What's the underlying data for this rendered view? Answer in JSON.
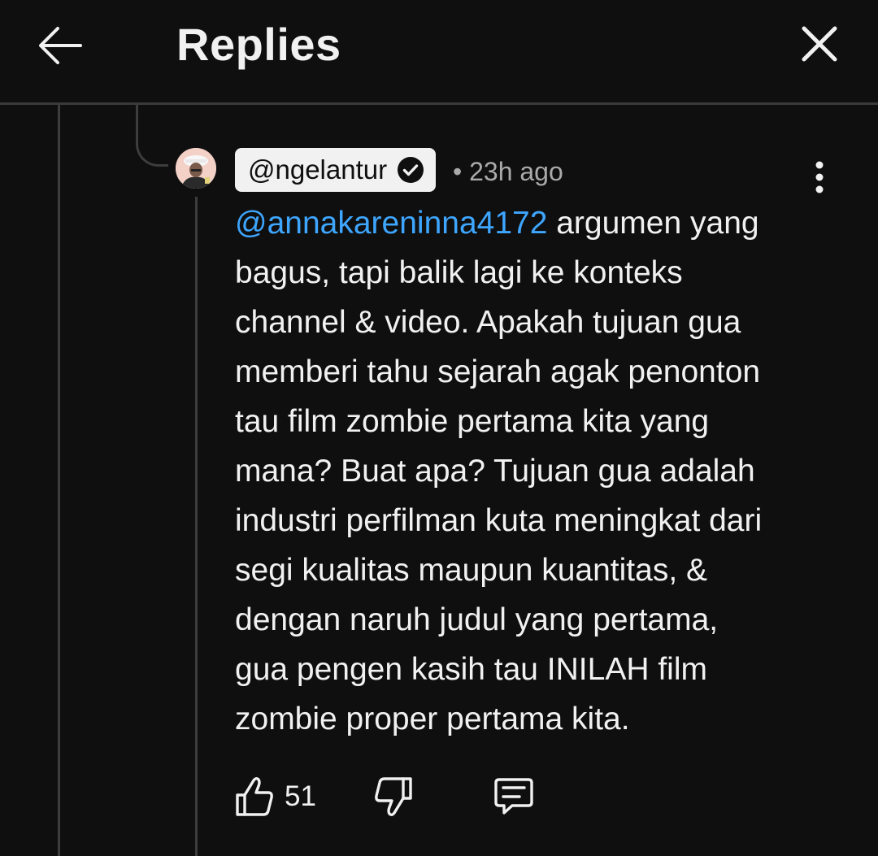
{
  "header": {
    "title": "Replies",
    "back_icon": "arrow-left-icon",
    "close_icon": "close-icon"
  },
  "comment": {
    "author": "@ngelantur",
    "verified_icon": "verified-check-icon",
    "time": "• 23h ago",
    "mention": "@annakareninna4172",
    "body": " argumen yang\nbagus, tapi balik lagi ke konteks\nchannel & video. Apakah tujuan gua\nmemberi tahu sejarah agak penonton\ntau film zombie pertama kita yang\nmana? Buat apa? Tujuan gua adalah\nindustri perfilman kuta meningkat dari\nsegi kualitas maupun kuantitas, &\ndengan naruh judul yang pertama,\ngua pengen kasih tau INILAH film\nzombie proper pertama kita.",
    "likes": "51",
    "more_icon": "more-vertical-icon",
    "like_icon": "thumbs-up-icon",
    "dislike_icon": "thumbs-down-icon",
    "reply_icon": "reply-comment-icon"
  },
  "colors": {
    "background": "#0f0f0f",
    "text": "#f1f1f1",
    "secondary_text": "#aaaaaa",
    "mention": "#3ea6ff",
    "thread_line": "#3d3d3d",
    "author_chip": "#f1f1f1"
  }
}
